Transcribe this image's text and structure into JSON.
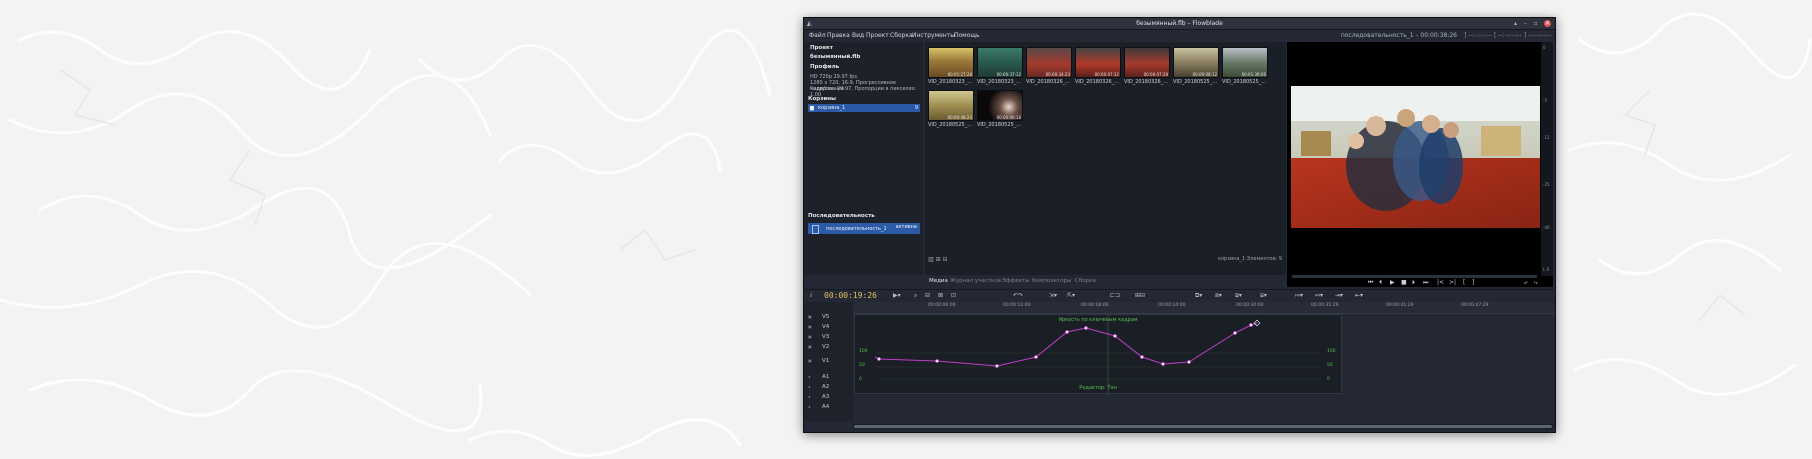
{
  "window": {
    "title": "безымянный.flb – Flowblade",
    "controls": [
      "▴",
      "–",
      "▫",
      "✕"
    ]
  },
  "menu": [
    "Файл",
    "Правка",
    "Вид",
    "Проект",
    "Сборка",
    "Инструменты",
    "Помощь"
  ],
  "header_right": {
    "sequence_info": "последовательность_1 – 00:00:38:26",
    "mark_in": "] --:--:--:--",
    "mark_out": "[ --:--:--:--",
    "duration": "] --:--:--:--"
  },
  "project": {
    "heading": "Проект",
    "name": "безымянный.flb",
    "profile_heading": "Профиль",
    "profile_line1": "HD 720p 29.97 fps",
    "profile_line2": "1280 x 720, 16:9, Прогрессивное кодирование",
    "profile_line3": "Кадр/сек: 29.97, Пропорции в пикселях: 1.00",
    "bins_heading": "Корзины",
    "bin_name": "корзина_1",
    "bin_count": "9",
    "sequences_heading": "Последовательность",
    "sequence_name": "последовательность_1",
    "sequence_state": "активна"
  },
  "media": {
    "clips": [
      {
        "name": "VID_20180323_...",
        "tc": "00:01:27:28"
      },
      {
        "name": "VID_20180323_...",
        "tc": "00:00:37:12"
      },
      {
        "name": "VID_20180326_...",
        "tc": "00:00:34:23"
      },
      {
        "name": "VID_20180326_...",
        "tc": "00:00:07:32"
      },
      {
        "name": "VID_20180326_...",
        "tc": "00:00:07:28"
      },
      {
        "name": "VID_20180525_...",
        "tc": "00:00:08:12"
      },
      {
        "name": "VID_20180525_...",
        "tc": "00:01:39:06"
      },
      {
        "name": "VID_20180525_...",
        "tc": "00:00:48:24"
      },
      {
        "name": "VID_20180525_...",
        "tc": "00:00:06:18"
      }
    ],
    "count_label": "корзина_1   Элементов: 9",
    "tools": "▥   ⊞  ⊟"
  },
  "tabs": [
    "Медиа",
    "Журнал участков",
    "Эффекты",
    "Композиторы",
    "Сборка"
  ],
  "vu_marks": [
    "0",
    "-5",
    "-12",
    "-25",
    "-40",
    "L R"
  ],
  "preview_tools": [
    "⏮",
    "⏴",
    "▶",
    "■",
    "⏵",
    "⏭",
    "|<",
    ">|",
    "[",
    "]",
    "⤶",
    "⤷"
  ],
  "timeline": {
    "timecode": "00:00:19:26",
    "ruler": [
      "00:00:06:00",
      "00:00:12:00",
      "00:00:18:00",
      "00:00:24:00",
      "00:00:30:00",
      "00:00:35:29",
      "00:00:41:29",
      "00:00:47:29"
    ],
    "tracks": [
      "V5",
      "V4",
      "V3",
      "V2",
      "V1",
      "A1",
      "A2",
      "A3",
      "A4"
    ],
    "keyframe_title": "Яркость по ключевым кадрам",
    "keyframe_footer": "Редактор: Тон",
    "scale_left": [
      "100",
      "50",
      "0"
    ],
    "scale_right": [
      "100",
      "50",
      "0"
    ]
  },
  "colors": {
    "accent": "#2b5aa8",
    "keyframe_line": "#c040c8",
    "keyframe_text": "#56c04c",
    "timecode": "#e0c25a"
  }
}
